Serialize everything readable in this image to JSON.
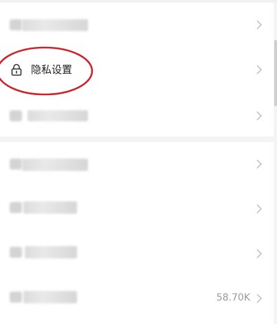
{
  "settings": {
    "privacy_label": "隐私设置",
    "cache_value": "58.70K"
  },
  "colors": {
    "annotation_circle": "#d0202a",
    "chevron": "#c4c4c4",
    "value_text": "#999999"
  },
  "icons": {
    "privacy": "lock-icon",
    "arrow": "chevron-right-icon"
  }
}
